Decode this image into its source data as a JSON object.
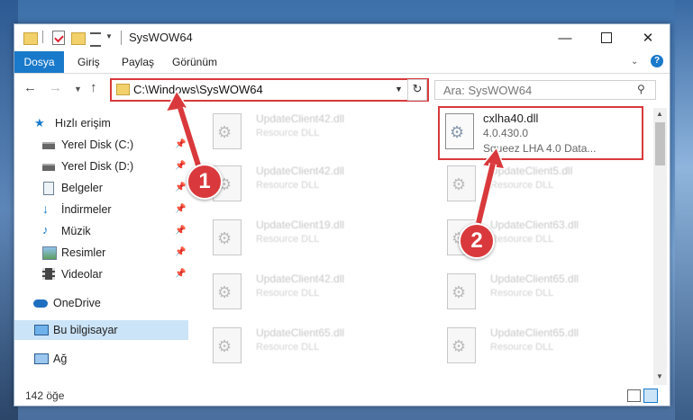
{
  "window": {
    "title": "SysWOW64",
    "min_glyph": "—",
    "close_glyph": "✕"
  },
  "ribbon": {
    "tabs": [
      "Dosya",
      "Giriş",
      "Paylaş",
      "Görünüm"
    ],
    "expand_glyph": "⌄",
    "help_glyph": "?"
  },
  "nav": {
    "back_glyph": "←",
    "forward_glyph": "→",
    "recent_glyph": "▼",
    "up_glyph": "↑",
    "address": "C:\\Windows\\SysWOW64",
    "address_drop_glyph": "▼",
    "refresh_glyph": "↻",
    "search_placeholder": "Ara: SysWOW64",
    "search_glyph": "⚲"
  },
  "sidebar": {
    "items": [
      {
        "label": "Hızlı erişim",
        "icon": "star-icon",
        "pinned": false
      },
      {
        "label": "Yerel Disk (C:)",
        "icon": "drive-icon",
        "pinned": true
      },
      {
        "label": "Yerel Disk (D:)",
        "icon": "drive-icon",
        "pinned": true
      },
      {
        "label": "Belgeler",
        "icon": "document-icon",
        "pinned": true
      },
      {
        "label": "İndirmeler",
        "icon": "download-icon",
        "pinned": true
      },
      {
        "label": "Müzik",
        "icon": "music-icon",
        "pinned": true
      },
      {
        "label": "Resimler",
        "icon": "pictures-icon",
        "pinned": true
      },
      {
        "label": "Videolar",
        "icon": "video-icon",
        "pinned": true
      },
      {
        "label": "OneDrive",
        "icon": "cloud-icon",
        "pinned": false
      },
      {
        "label": "Bu bilgisayar",
        "icon": "computer-icon",
        "pinned": false,
        "selected": true
      },
      {
        "label": "Ağ",
        "icon": "network-icon",
        "pinned": false
      }
    ],
    "pin_glyph": "📌"
  },
  "files": {
    "focused": {
      "name": "cxlha40.dll",
      "version": "4.0.430.0",
      "description": "Squeez LHA 4.0 Data..."
    },
    "left_column": [
      {
        "name": "UpdateClient42.dll",
        "type": "Resource DLL"
      },
      {
        "name": "UpdateClient42.dll",
        "type": "Resource DLL"
      },
      {
        "name": "UpdateClient19.dll",
        "type": "Resource DLL"
      },
      {
        "name": "UpdateClient42.dll",
        "type": "Resource DLL"
      },
      {
        "name": "UpdateClient65.dll",
        "type": "Resource DLL"
      }
    ],
    "right_column": [
      {
        "name": "UpdateClient5.dll",
        "type": "Resource DLL"
      },
      {
        "name": "UpdateClient63.dll",
        "type": "Resource DLL"
      },
      {
        "name": "UpdateClient65.dll",
        "type": "Resource DLL"
      },
      {
        "name": "UpdateClient65.dll",
        "type": "Resource DLL"
      }
    ]
  },
  "status": {
    "count": "142 öğe"
  },
  "callouts": {
    "first": "1",
    "second": "2"
  },
  "colors": {
    "accent": "#1979ca",
    "highlight": "#d9393c",
    "selected": "#cce4f7"
  }
}
